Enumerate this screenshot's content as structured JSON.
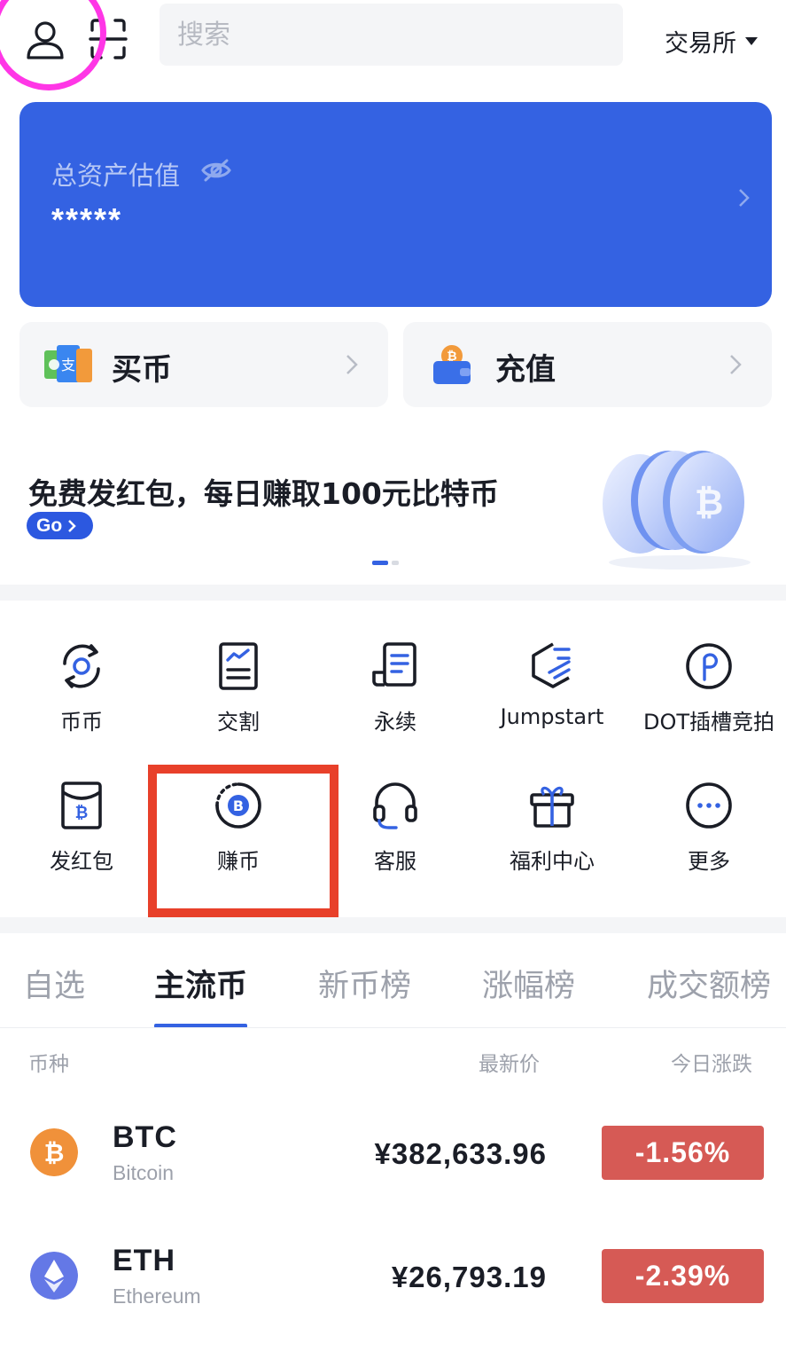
{
  "header": {
    "search_placeholder": "搜索",
    "exchange_label": "交易所"
  },
  "asset": {
    "label": "总资产估值",
    "value": "*****"
  },
  "quick": {
    "buy_label": "买币",
    "deposit_label": "充值"
  },
  "promo": {
    "title": "免费发红包，每日赚取100元比特币",
    "go_label": "Go"
  },
  "grid": {
    "items": [
      {
        "label": "币币",
        "icon": "spot-exchange-icon"
      },
      {
        "label": "交割",
        "icon": "delivery-contract-icon"
      },
      {
        "label": "永续",
        "icon": "perpetual-icon"
      },
      {
        "label": "Jumpstart",
        "icon": "jumpstart-icon"
      },
      {
        "label": "DOT插槽竞拍",
        "icon": "polkadot-icon"
      },
      {
        "label": "发红包",
        "icon": "red-envelope-icon"
      },
      {
        "label": "赚币",
        "icon": "earn-bitcoin-icon"
      },
      {
        "label": "客服",
        "icon": "headset-icon"
      },
      {
        "label": "福利中心",
        "icon": "gift-icon"
      },
      {
        "label": "更多",
        "icon": "more-icon"
      }
    ]
  },
  "tabs": [
    "自选",
    "主流币",
    "新币榜",
    "涨幅榜",
    "成交额榜"
  ],
  "active_tab": "主流币",
  "columns": {
    "coin": "币种",
    "price": "最新价",
    "change": "今日涨跌"
  },
  "markets": [
    {
      "symbol": "BTC",
      "name": "Bitcoin",
      "price": "¥382,633.96",
      "change": "-1.56%"
    },
    {
      "symbol": "ETH",
      "name": "Ethereum",
      "price": "¥26,793.19",
      "change": "-2.39%"
    }
  ],
  "colors": {
    "accent": "#3462e2",
    "down": "#d65a55",
    "annotation_ring": "#ff36e6",
    "annotation_box": "#e8402a"
  }
}
